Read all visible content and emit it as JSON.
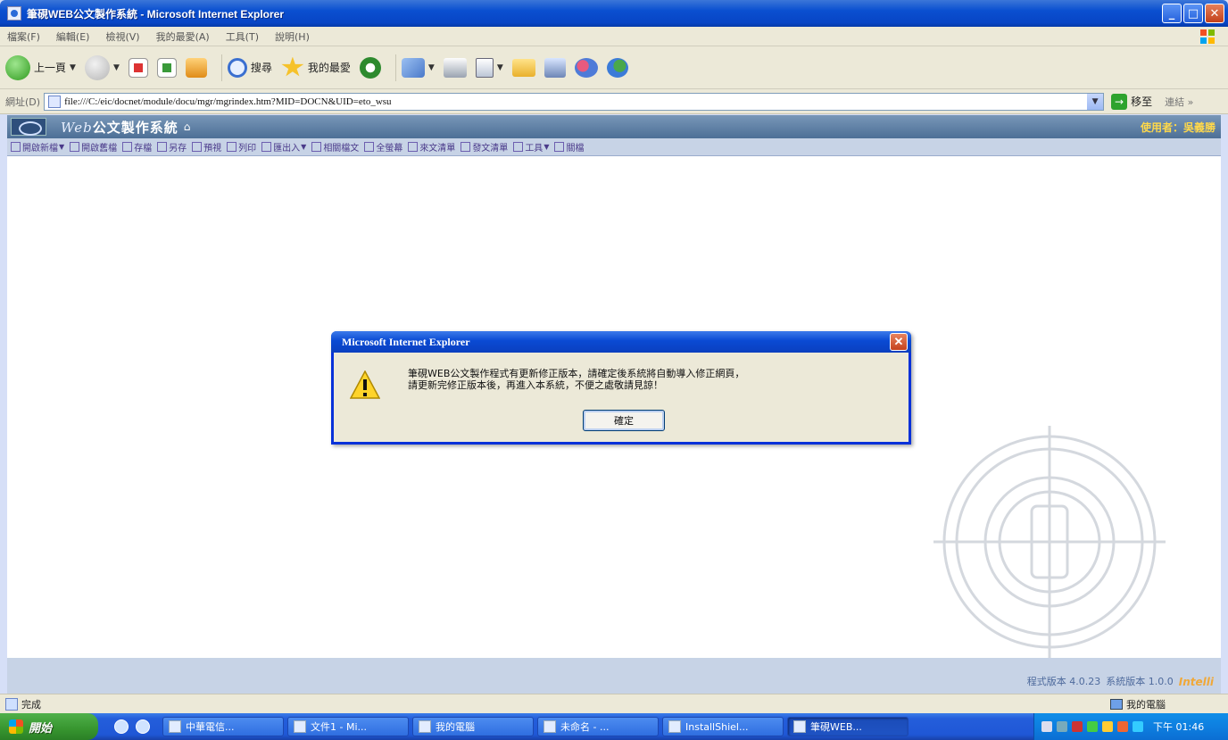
{
  "window": {
    "title": "筆硯WEB公文製作系統 - Microsoft Internet Explorer",
    "buttons": {
      "minimize": "_",
      "maximize": "□",
      "close": "✕"
    }
  },
  "menu": [
    "檔案(F)",
    "編輯(E)",
    "檢視(V)",
    "我的最愛(A)",
    "工具(T)",
    "說明(H)"
  ],
  "toolbar": {
    "back_label": "上一頁",
    "search_label": "搜尋",
    "favorites_label": "我的最愛"
  },
  "address": {
    "label": "網址(D)",
    "url": "file:///C:/eic/docnet/module/docu/mgr/mgrindex.htm?MID=DOCN&UID=eto_wsu",
    "go_label": "移至",
    "links_label": "連結 »"
  },
  "app": {
    "title_web": "Web",
    "title_rest": "公文製作系統",
    "user": "使用者：吳義勝",
    "tools": [
      {
        "label": "開啟新檔",
        "dropdown": true
      },
      {
        "label": "開啟舊檔",
        "dropdown": false
      },
      {
        "label": "存檔",
        "dropdown": false
      },
      {
        "label": "另存",
        "dropdown": false
      },
      {
        "label": "預視",
        "dropdown": false
      },
      {
        "label": "列印",
        "dropdown": false
      },
      {
        "label": "匯出入",
        "dropdown": true
      },
      {
        "label": "相關檔文",
        "dropdown": false
      },
      {
        "label": "全螢幕",
        "dropdown": false
      },
      {
        "label": "來文清單",
        "dropdown": false
      },
      {
        "label": "發文清單",
        "dropdown": false
      },
      {
        "label": "工具",
        "dropdown": true
      },
      {
        "label": "關檔",
        "dropdown": false
      }
    ],
    "version": "程式版本 4.0.23",
    "system_version": "系統版本 1.0.0",
    "brand": "Intelli"
  },
  "status": {
    "text": "完成",
    "zone": "我的電腦"
  },
  "taskbar": {
    "start": "開始",
    "tasks": [
      {
        "label": "中華電信...",
        "active": false
      },
      {
        "label": "文件1 - Mi...",
        "active": false
      },
      {
        "label": "我的電腦",
        "active": false
      },
      {
        "label": "未命名 - ...",
        "active": false
      },
      {
        "label": "InstallShiel...",
        "active": false
      },
      {
        "label": "筆硯WEB...",
        "active": true
      }
    ],
    "clock": "下午 01:46"
  },
  "dialog": {
    "title": "Microsoft Internet Explorer",
    "line1": "筆硯WEB公文製作程式有更新修正版本，請確定後系統將自動導入修正網頁，",
    "line2": "請更新完修正版本後，再進入本系統，不便之處敬請見諒！",
    "ok": "確定"
  },
  "colors": {
    "xp_blue": "#0a4fd0",
    "app_header": "#4d6f96",
    "user_name": "#ffd84a"
  }
}
